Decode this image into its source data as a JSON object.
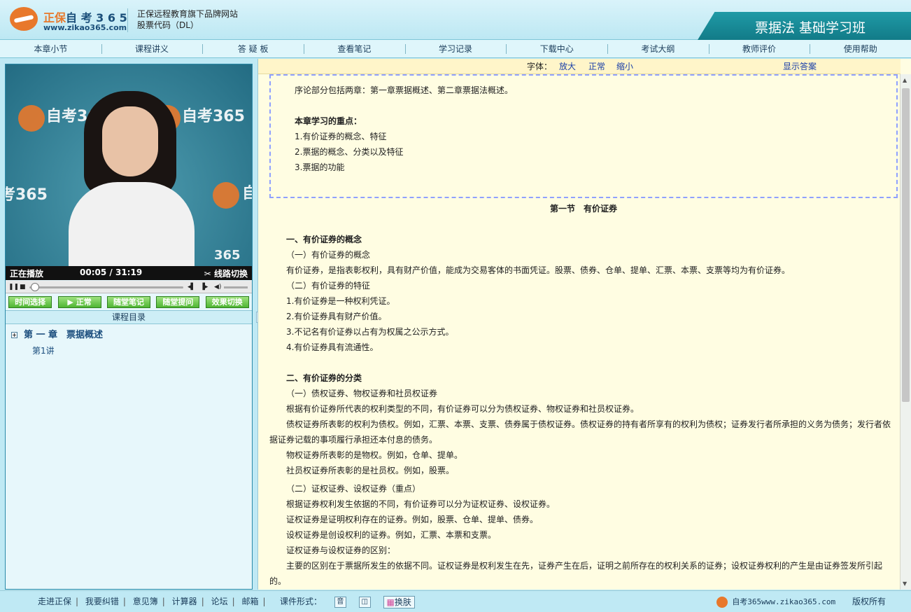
{
  "header": {
    "brand_primary": "正保",
    "brand_secondary": "自 考 3 6 5",
    "brand_url": "www.zikao365.com",
    "tagline_line1": "正保远程教育旗下品牌网站",
    "tagline_line2": "股票代码（DL）",
    "course_title": "票据法 基础学习班",
    "accent_color": "#1a8f9c",
    "logo_color": "#e8782b"
  },
  "nav": {
    "items": [
      "本章小节",
      "课程讲义",
      "答 疑 板",
      "查看笔记",
      "学习记录",
      "下载中心",
      "考试大纲",
      "教师评价",
      "使用帮助"
    ]
  },
  "player": {
    "watermarks": [
      "自考365",
      "自考365",
      "考365",
      "自",
      "365"
    ],
    "status": "正在播放",
    "time_current": "00:05",
    "time_sep": "/",
    "time_total": "31:19",
    "switch_label": "线路切换",
    "progress": 0.003,
    "buttons": [
      "时间选择",
      "正常",
      "随堂笔记",
      "随堂提问",
      "效果切换"
    ]
  },
  "catalog": {
    "title": "课程目录",
    "chapter": "第 一 章　票据概述",
    "lessons": [
      "第1讲"
    ]
  },
  "fontbar": {
    "label": "字体：",
    "larger": "放大",
    "normal": "正常",
    "smaller": "缩小",
    "show_answer": "显示答案"
  },
  "content": {
    "intro": "序论部分包括两章：第一章票据概述、第二章票据法概述。",
    "focus_title": "本章学习的重点：",
    "focus_items": [
      "1.有价证券的概念、特征",
      "2.票据的概念、分类以及特征",
      "3.票据的功能"
    ],
    "section_title": "第一节　有价证券",
    "s1_title": "一、有价证券的概念",
    "s1_sub1": "（一）有价证券的概念",
    "s1_p1": "有价证券，是指表彰权利，具有财产价值，能成为交易客体的书面凭证。股票、债券、仓单、提单、汇票、本票、支票等均为有价证券。",
    "s1_sub2": "（二）有价证券的特征",
    "s1_items": [
      "1.有价证券是一种权利凭证。",
      "2.有价证券具有财产价值。",
      "3.不记名有价证券以占有为权属之公示方式。",
      "4.有价证券具有流通性。"
    ],
    "s2_title": "二、有价证券的分类",
    "s2_sub1": "（一）债权证券、物权证券和社员权证券",
    "s2_p1": "根据有价证券所代表的权利类型的不同，有价证券可以分为债权证券、物权证券和社员权证券。",
    "s2_p2": "债权证券所表彰的权利为债权。例如，汇票、本票、支票、债券属于债权证券。债权证券的持有者所享有的权利为债权；证券发行者所承担的义务为债务；发行者依据证券记载的事项履行承担还本付息的债务。",
    "s2_p3": "物权证券所表彰的是物权。例如，仓单、提单。",
    "s2_p4": "社员权证券所表彰的是社员权。例如，股票。",
    "s2_sub2": "（二）证权证券、设权证券（重点）",
    "s2_p5": "根据证券权利发生依据的不同，有价证券可以分为证权证券、设权证券。",
    "s2_p6": "证权证券是证明权利存在的证券。例如，股票、仓单、提单、债券。",
    "s2_p7": "设权证券是创设权利的证券。例如，汇票、本票和支票。",
    "s2_p8": "证权证券与设权证券的区别：",
    "s2_p9": "主要的区别在于票据所发生的依据不同。证权证券是权利发生在先，证券产生在后，证明之前所存在的权利关系的证券；设权证券权利的产生是由证券签发所引起的。"
  },
  "footer": {
    "links": [
      "走进正保",
      "我要纠错",
      "意见簿",
      "计算器",
      "论坛",
      "邮箱"
    ],
    "courseware_label": "课件形式：",
    "audio_icon_label": "音",
    "skin_label": "换肤",
    "site": "自考365www.zikao365.com",
    "copyright": "版权所有"
  }
}
